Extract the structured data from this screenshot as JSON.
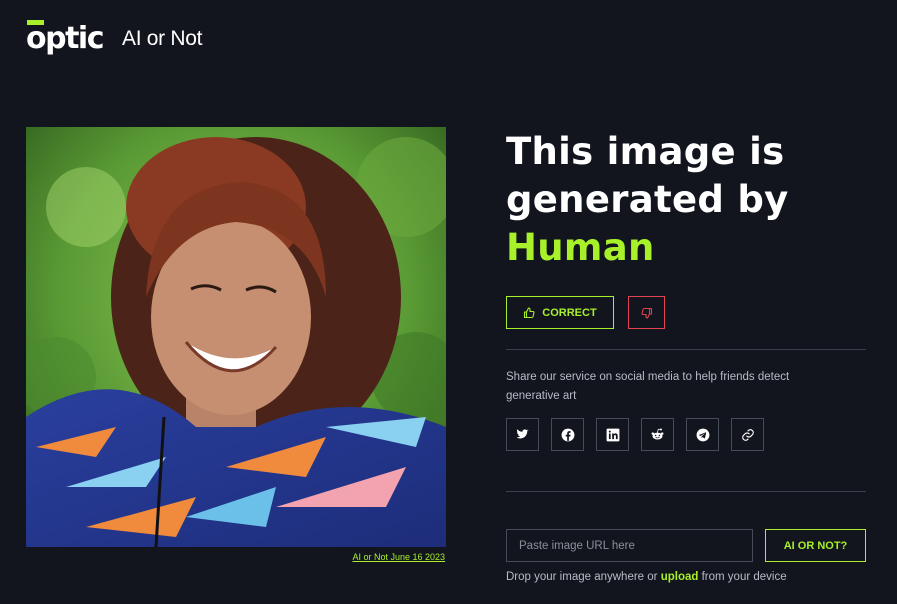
{
  "header": {
    "logo_word": "optic",
    "logo_subtitle": "AI or Not"
  },
  "image": {
    "caption": "AI or Not June 16 2023"
  },
  "result": {
    "line1": "This image is",
    "line2": "generated by",
    "verdict": "Human"
  },
  "feedback": {
    "correct_label": "CORRECT"
  },
  "share": {
    "text": "Share our service on social media to help friends detect generative art",
    "icons": [
      "twitter-icon",
      "facebook-icon",
      "linkedin-icon",
      "reddit-icon",
      "telegram-icon",
      "link-icon"
    ]
  },
  "upload": {
    "url_placeholder": "Paste image URL here",
    "submit_label": "AI OR NOT?",
    "drop_prefix": "Drop your image anywhere or",
    "drop_link": "upload",
    "drop_suffix": "from your device"
  },
  "colors": {
    "background": "#12151d",
    "accent": "#a8f02a",
    "danger": "#e0424f"
  }
}
